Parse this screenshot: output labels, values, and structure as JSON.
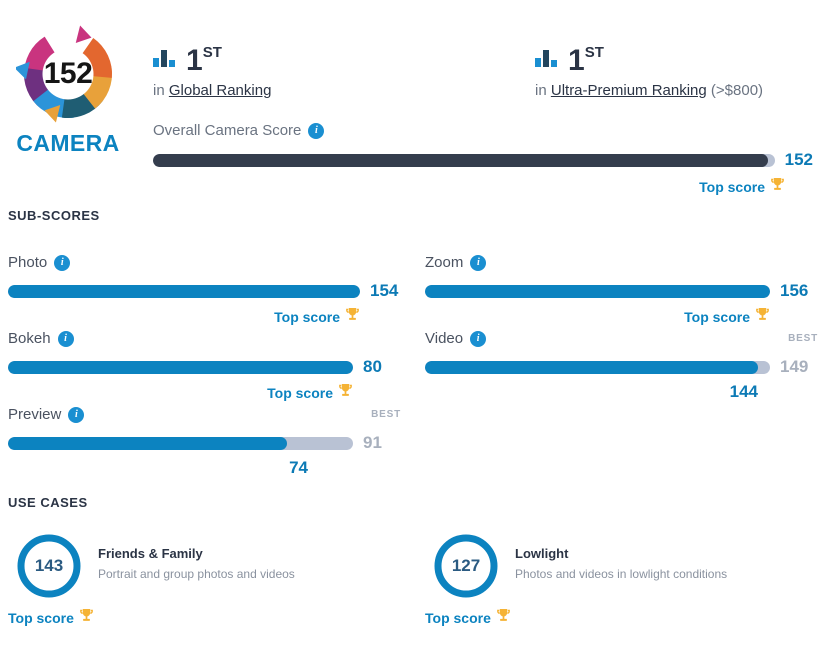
{
  "logo": {
    "score": "152",
    "word": "CAMERA",
    "ring_colors": [
      "#c9347f",
      "#6e3080",
      "#2b94d9",
      "#1f5d73",
      "#e8a13a",
      "#e3672f"
    ]
  },
  "rankings": [
    {
      "icon": "bar-chart-icon",
      "position": "1",
      "suffix": "ST",
      "prefix": "in",
      "link": "Global Ranking",
      "paren": ""
    },
    {
      "icon": "bar-chart-icon",
      "position": "1",
      "suffix": "ST",
      "prefix": "in",
      "link": "Ultra-Premium Ranking",
      "paren": "(>$800)"
    }
  ],
  "overall": {
    "label": "Overall Camera Score",
    "value": "152",
    "fill_pct": 99,
    "fill_color": "#343d4d",
    "top_score_label": "Top score",
    "is_top": true
  },
  "sections": {
    "sub_scores": "SUB-SCORES",
    "use_cases": "USE CASES"
  },
  "sub_scores": [
    {
      "label": "Photo",
      "value": "154",
      "fill_pct": 100,
      "is_top": true,
      "top_score_label": "Top score",
      "best_tag": "",
      "best_value": "",
      "under_value": ""
    },
    {
      "label": "Zoom",
      "value": "156",
      "fill_pct": 100,
      "is_top": true,
      "top_score_label": "Top score",
      "best_tag": "",
      "best_value": "",
      "under_value": ""
    },
    {
      "label": "Bokeh",
      "value": "80",
      "fill_pct": 100,
      "is_top": true,
      "top_score_label": "Top score",
      "best_tag": "",
      "best_value": "",
      "under_value": ""
    },
    {
      "label": "Video",
      "value": "149",
      "fill_pct": 96.5,
      "is_top": false,
      "top_score_label": "",
      "best_tag": "BEST",
      "best_value": "149",
      "under_value": "144"
    },
    {
      "label": "Preview",
      "value": "91",
      "fill_pct": 81,
      "is_top": false,
      "top_score_label": "",
      "best_tag": "BEST",
      "best_value": "91",
      "under_value": "74"
    }
  ],
  "use_cases": [
    {
      "score": "143",
      "title": "Friends & Family",
      "desc": "Portrait and group photos and videos",
      "top_score_label": "Top score"
    },
    {
      "score": "127",
      "title": "Lowlight",
      "desc": "Photos and videos in lowlight conditions",
      "top_score_label": "Top score"
    }
  ],
  "colors": {
    "brand_blue": "#0c83c0",
    "dark_navy": "#343d4d",
    "track_gray": "#b9c2d4",
    "trophy_gold": "#f5b335"
  }
}
